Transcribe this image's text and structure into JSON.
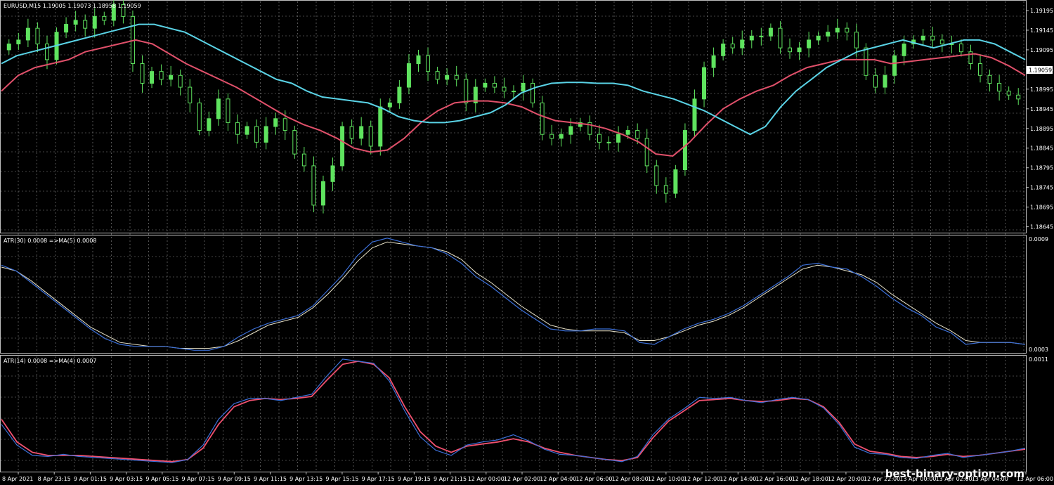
{
  "main_title": "EURUSD,M15  1.19005 1.19073 1.18958 1.19059",
  "atr30_title": "ATR(30) 0.0008  =>MA(5) 0.0008",
  "atr14_title": "ATR(14) 0.0008  =>MA(4) 0.0007",
  "watermark": "best-binary-option.com",
  "colors": {
    "background": "#000000",
    "grid": "#8a8a8a",
    "frame": "#bfbfbf",
    "candle": "#5fe35f",
    "ma_fast": "#5ad3e6",
    "ma_slow": "#e0506a",
    "atr_line": "#3b6fd8",
    "atr30_ma": "#e8e2c8",
    "atr14_ma": "#f0506e"
  },
  "chart_data": [
    {
      "type": "candlestick",
      "title": "EURUSD,M15  1.19005 1.19073 1.18958 1.19059",
      "ylim": [
        1.1863,
        1.1922
      ],
      "y_ticks": [
        "1.19195",
        "1.19145",
        "1.19095",
        "1.19045",
        "1.18995",
        "1.18945",
        "1.18895",
        "1.18845",
        "1.18795",
        "1.18745",
        "1.18695",
        "1.18645"
      ],
      "current_price": "1.19059",
      "close_series": [
        1.1911,
        1.1912,
        1.1915,
        1.1911,
        1.1907,
        1.1914,
        1.1916,
        1.1917,
        1.1915,
        1.1918,
        1.1917,
        1.1921,
        1.1918,
        1.1906,
        1.1901,
        1.1904,
        1.1902,
        1.1903,
        1.19,
        1.1896,
        1.1889,
        1.1892,
        1.1897,
        1.1891,
        1.1888,
        1.189,
        1.1886,
        1.189,
        1.1892,
        1.1889,
        1.1883,
        1.188,
        1.187,
        1.1876,
        1.188,
        1.189,
        1.1887,
        1.189,
        1.1885,
        1.1895,
        1.1896,
        1.19,
        1.1906,
        1.1908,
        1.1904,
        1.1902,
        1.1903,
        1.1902,
        1.1896,
        1.19,
        1.1901,
        1.19,
        1.1899,
        1.1899,
        1.1901,
        1.1896,
        1.1888,
        1.1887,
        1.1888,
        1.189,
        1.1891,
        1.1888,
        1.1886,
        1.1886,
        1.1888,
        1.1889,
        1.1887,
        1.188,
        1.1875,
        1.1873,
        1.1879,
        1.1889,
        1.1897,
        1.1905,
        1.1908,
        1.1911,
        1.191,
        1.1912,
        1.1913,
        1.1913,
        1.1915,
        1.191,
        1.1909,
        1.191,
        1.1912,
        1.1913,
        1.1914,
        1.1915,
        1.1914,
        1.191,
        1.1903,
        1.19,
        1.1903,
        1.1908,
        1.1911,
        1.1912,
        1.1913,
        1.1912,
        1.1911,
        1.1911,
        1.1909,
        1.1906,
        1.1903,
        1.1901,
        1.1899,
        1.1898,
        1.1897
      ],
      "ma_fast": [
        1.1906,
        1.1908,
        1.1909,
        1.191,
        1.1911,
        1.1912,
        1.1913,
        1.1914,
        1.1915,
        1.1916,
        1.1916,
        1.1915,
        1.1914,
        1.1912,
        1.191,
        1.1908,
        1.1906,
        1.1904,
        1.1902,
        1.1901,
        1.1899,
        1.18975,
        1.1897,
        1.18965,
        1.1896,
        1.18945,
        1.18925,
        1.18915,
        1.1891,
        1.1891,
        1.18915,
        1.18925,
        1.18935,
        1.18955,
        1.18985,
        1.19,
        1.1901,
        1.19012,
        1.19012,
        1.1901,
        1.1901,
        1.19005,
        1.1899,
        1.1898,
        1.1897,
        1.18955,
        1.1894,
        1.1892,
        1.189,
        1.1888,
        1.189,
        1.1895,
        1.1899,
        1.1902,
        1.1905,
        1.1907,
        1.1909,
        1.191,
        1.1911,
        1.1912,
        1.1911,
        1.191,
        1.1911,
        1.1912,
        1.1912,
        1.1911,
        1.1909,
        1.1907
      ],
      "ma_slow": [
        1.1899,
        1.1903,
        1.1905,
        1.1906,
        1.1907,
        1.1909,
        1.191,
        1.1911,
        1.1912,
        1.1911,
        1.19085,
        1.1906,
        1.1904,
        1.1902,
        1.19,
        1.18975,
        1.1895,
        1.18925,
        1.18905,
        1.1889,
        1.1887,
        1.18845,
        1.18835,
        1.1884,
        1.1887,
        1.1891,
        1.1894,
        1.1896,
        1.18965,
        1.18965,
        1.1896,
        1.1895,
        1.1893,
        1.18915,
        1.1891,
        1.18905,
        1.18895,
        1.1888,
        1.1886,
        1.1883,
        1.18825,
        1.1886,
        1.18905,
        1.18945,
        1.1897,
        1.1899,
        1.19005,
        1.1903,
        1.1905,
        1.1906,
        1.1907,
        1.1907,
        1.1907,
        1.1906,
        1.19065,
        1.1907,
        1.19075,
        1.1908,
        1.19085,
        1.19075,
        1.19055,
        1.1903
      ]
    },
    {
      "type": "line",
      "title": "ATR(30) 0.0008  =>MA(5) 0.0008",
      "ylim": [
        0.0003,
        0.0009
      ],
      "y_ticks": [
        "0.0009",
        "0.0003"
      ],
      "series": [
        {
          "name": "ATR(30)",
          "values": [
            0.00075,
            0.00072,
            0.00066,
            0.0006,
            0.00054,
            0.00048,
            0.00042,
            0.00037,
            0.00034,
            0.00033,
            0.00033,
            0.00033,
            0.00032,
            0.00031,
            0.00031,
            0.00033,
            0.00038,
            0.00042,
            0.00045,
            0.00047,
            0.00049,
            0.00054,
            0.00062,
            0.0007,
            0.0008,
            0.00087,
            0.00089,
            0.00087,
            0.00085,
            0.00084,
            0.00081,
            0.00076,
            0.00069,
            0.00064,
            0.00058,
            0.00052,
            0.00047,
            0.00042,
            0.00041,
            0.00041,
            0.00042,
            0.00042,
            0.00041,
            0.00035,
            0.00034,
            0.00038,
            0.00042,
            0.00045,
            0.00047,
            0.0005,
            0.00054,
            0.00059,
            0.00064,
            0.00069,
            0.00075,
            0.00076,
            0.00074,
            0.00073,
            0.00069,
            0.00064,
            0.00058,
            0.00053,
            0.00049,
            0.00043,
            0.0004,
            0.00034,
            0.00035,
            0.00035,
            0.00035,
            0.00034
          ]
        },
        {
          "name": "MA(5)",
          "values": [
            0.00074,
            0.00072,
            0.00067,
            0.00061,
            0.00055,
            0.00049,
            0.00043,
            0.00039,
            0.00035,
            0.00034,
            0.00033,
            0.00033,
            0.00032,
            0.00032,
            0.00032,
            0.00033,
            0.00036,
            0.0004,
            0.00044,
            0.00046,
            0.00048,
            0.00053,
            0.0006,
            0.00068,
            0.00077,
            0.00084,
            0.00087,
            0.00086,
            0.00085,
            0.00084,
            0.00082,
            0.00078,
            0.00071,
            0.00066,
            0.0006,
            0.00054,
            0.00049,
            0.00044,
            0.00042,
            0.00041,
            0.00041,
            0.00041,
            0.0004,
            0.00036,
            0.00036,
            0.00038,
            0.00041,
            0.00044,
            0.00046,
            0.00049,
            0.00053,
            0.00058,
            0.00063,
            0.00068,
            0.00073,
            0.00075,
            0.00074,
            0.00072,
            0.0007,
            0.00066,
            0.0006,
            0.00055,
            0.0005,
            0.00045,
            0.00041,
            0.00036,
            0.00035,
            0.00035,
            0.00035,
            0.00034
          ]
        }
      ]
    },
    {
      "type": "line",
      "title": "ATR(14) 0.0008  =>MA(4) 0.0007",
      "ylim": [
        0.0,
        0.0011
      ],
      "y_ticks": [
        "0.0011"
      ],
      "series": [
        {
          "name": "ATR(14)",
          "values": [
            0.00045,
            0.00025,
            0.00015,
            0.00014,
            0.00016,
            0.00014,
            0.00013,
            0.00012,
            0.00011,
            0.0001,
            9e-05,
            8e-05,
            0.00011,
            0.00025,
            0.0005,
            0.00065,
            0.0007,
            0.0007,
            0.00068,
            0.00071,
            0.00074,
            0.00092,
            0.00108,
            0.00106,
            0.00104,
            0.00087,
            0.00058,
            0.00033,
            0.0002,
            0.00015,
            0.00025,
            0.00028,
            0.0003,
            0.00035,
            0.00029,
            0.00021,
            0.00016,
            0.00015,
            0.00013,
            0.00011,
            9e-05,
            0.00014,
            0.00035,
            0.0005,
            0.0006,
            0.00071,
            0.0007,
            0.00071,
            0.00068,
            0.00066,
            0.00069,
            0.00071,
            0.00069,
            0.00061,
            0.00045,
            0.00023,
            0.00017,
            0.00016,
            0.00013,
            0.00012,
            0.00015,
            0.00017,
            0.00013,
            0.00015,
            0.00017,
            0.00019,
            0.00022
          ]
        },
        {
          "name": "MA(4)",
          "values": [
            0.0005,
            0.00028,
            0.00018,
            0.00015,
            0.00015,
            0.00015,
            0.00014,
            0.00013,
            0.00012,
            0.00011,
            0.0001,
            9e-05,
            0.00011,
            0.00022,
            0.00045,
            0.00062,
            0.00068,
            0.0007,
            0.00069,
            0.0007,
            0.00072,
            0.00088,
            0.00103,
            0.00106,
            0.00103,
            0.0009,
            0.00062,
            0.00038,
            0.00024,
            0.00018,
            0.00024,
            0.00026,
            0.00028,
            0.00031,
            0.00028,
            0.00022,
            0.00018,
            0.00015,
            0.00013,
            0.00011,
            0.0001,
            0.00013,
            0.00032,
            0.00048,
            0.00058,
            0.00068,
            0.00069,
            0.0007,
            0.00068,
            0.00067,
            0.00068,
            0.0007,
            0.00069,
            0.00062,
            0.00047,
            0.00026,
            0.00019,
            0.00017,
            0.00014,
            0.00013,
            0.00014,
            0.00016,
            0.00014,
            0.00015,
            0.00017,
            0.00019,
            0.00021
          ]
        }
      ]
    }
  ],
  "x_ticks": [
    "8 Apr 2021",
    "8 Apr 23:15",
    "9 Apr 01:15",
    "9 Apr 03:15",
    "9 Apr 05:15",
    "9 Apr 07:15",
    "9 Apr 09:15",
    "9 Apr 11:15",
    "9 Apr 13:15",
    "9 Apr 15:15",
    "9 Apr 17:15",
    "9 Apr 19:15",
    "9 Apr 21:15",
    "12 Apr 00:00",
    "12 Apr 02:00",
    "12 Apr 04:00",
    "12 Apr 06:00",
    "12 Apr 08:00",
    "12 Apr 10:00",
    "12 Apr 12:00",
    "12 Apr 14:00",
    "12 Apr 16:00",
    "12 Apr 18:00",
    "12 Apr 20:00",
    "12 Apr 22:00",
    "13 Apr 00:00",
    "13 Apr 02:00",
    "13 Apr 04:00",
    "13 Apr 06:00"
  ]
}
